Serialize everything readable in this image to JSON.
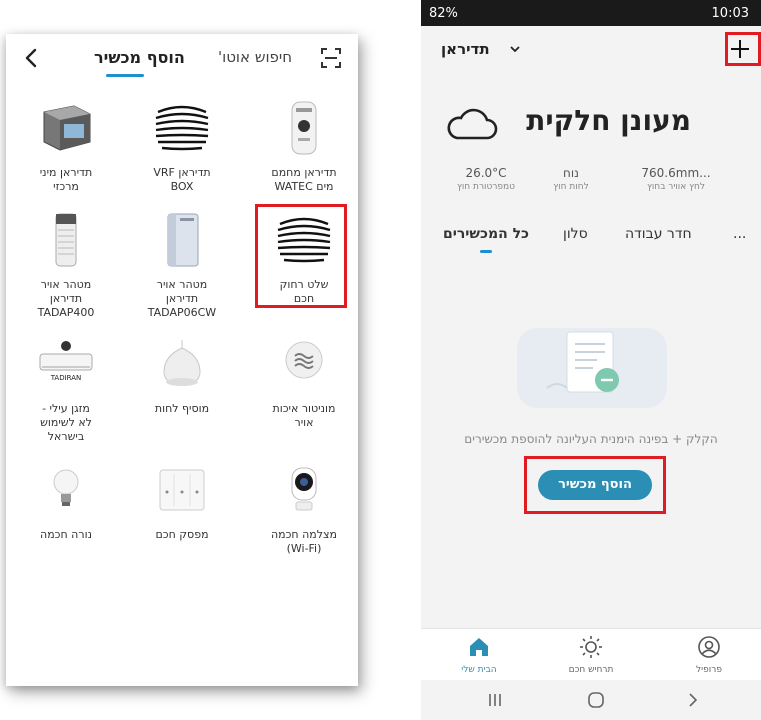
{
  "left": {
    "tab_add": "הוסף מכשיר",
    "tab_auto": "חיפוש אוטו'",
    "devices": [
      {
        "label": "תדיראן מחמם\nמים WATEC",
        "icon": "water-heater-icon"
      },
      {
        "label": "תדיראן VRF\nBOX",
        "icon": "tadiran-logo-icon"
      },
      {
        "label": "תדיראן מיני\nמרכזי",
        "icon": "mini-central-ac-icon"
      },
      {
        "label": "שלט רחוק\nחכם",
        "icon": "smart-remote-icon"
      },
      {
        "label": "מטהר אויר\nתדיראן\nTADAP06CW",
        "icon": "air-purifier-icon"
      },
      {
        "label": "מטהר אויר\nתדיראן\nTADAP400",
        "icon": "air-purifier-tower-icon"
      },
      {
        "label": "מוניטור איכות\nאויר",
        "icon": "air-quality-icon"
      },
      {
        "label": "מוסיף לחות",
        "icon": "humidifier-icon"
      },
      {
        "label": "מזגן עילי -\nלא לשימוש\nבישראל",
        "icon": "wall-ac-icon"
      },
      {
        "label": "מצלמה חכמה\n(Wi-Fi)",
        "icon": "camera-icon"
      },
      {
        "label": "מפסק חכם",
        "icon": "switch-icon"
      },
      {
        "label": "נורה חכמה",
        "icon": "bulb-icon"
      }
    ],
    "brand_text": "TADIRAN"
  },
  "right": {
    "status": {
      "battery": "82%",
      "time": "10:03"
    },
    "home_name": "תדיראן",
    "weather": {
      "title": "מעונן חלקית",
      "items": [
        {
          "value": "760.6mm...",
          "label": "לחץ אוויר בחוץ"
        },
        {
          "value": "נוח",
          "label": "לחות חוץ"
        },
        {
          "value": "26.0°C",
          "label": "טמפרטורת חוץ"
        }
      ]
    },
    "rooms": [
      "כל המכשירים",
      "סלון",
      "חדר עבודה",
      "..."
    ],
    "empty_hint": "הקלק + בפינה הימנית העליונה להוספת מכשירים",
    "add_device_button": "הוסף מכשיר",
    "nav": [
      {
        "label": "הבית שלי",
        "icon": "home-icon"
      },
      {
        "label": "תרחיש חכם",
        "icon": "sun-icon"
      },
      {
        "label": "פרופיל",
        "icon": "profile-icon"
      }
    ],
    "colors": {
      "accent": "#2b8fb5",
      "highlight": "#e11b22"
    }
  }
}
